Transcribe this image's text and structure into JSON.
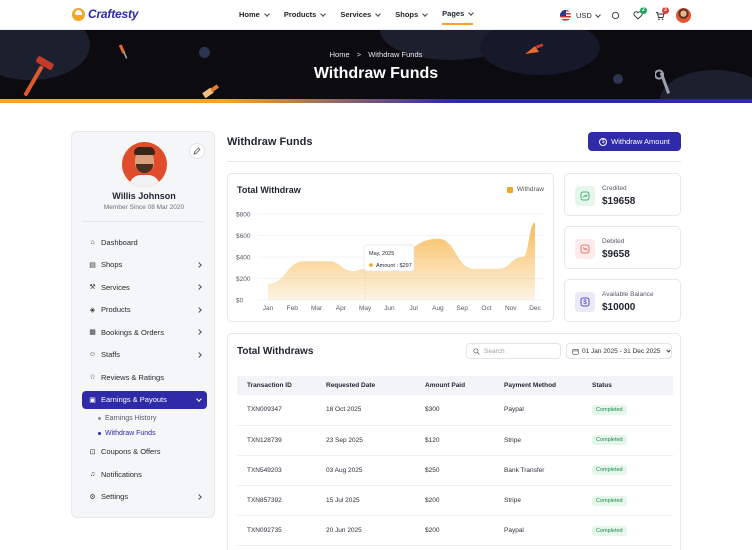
{
  "nav": {
    "logo": "Craftesty",
    "menu": [
      {
        "label": "Home"
      },
      {
        "label": "Products"
      },
      {
        "label": "Services"
      },
      {
        "label": "Shops"
      },
      {
        "label": "Pages"
      }
    ],
    "currency": "USD",
    "wishlist_count": "2",
    "cart_count": "3"
  },
  "hero": {
    "breadcrumb_home": "Home",
    "breadcrumb_sep": ">",
    "breadcrumb_current": "Withdraw Funds",
    "title": "Withdraw Funds"
  },
  "profile": {
    "name": "Willis Johnson",
    "since": "Member Since 08 Mar 2020"
  },
  "sidebar": {
    "items": [
      {
        "label": "Dashboard",
        "icon": "home-icon"
      },
      {
        "label": "Shops",
        "icon": "shop-icon"
      },
      {
        "label": "Services",
        "icon": "services-icon"
      },
      {
        "label": "Products",
        "icon": "box-icon"
      },
      {
        "label": "Bookings & Orders",
        "icon": "calendar-icon"
      },
      {
        "label": "Staffs",
        "icon": "users-icon"
      },
      {
        "label": "Reviews & Ratings",
        "icon": "star-icon"
      },
      {
        "label": "Earnings & Payouts",
        "icon": "wallet-icon"
      },
      {
        "label": "Coupons & Offers",
        "icon": "coupon-icon"
      },
      {
        "label": "Notifications",
        "icon": "bell-icon"
      },
      {
        "label": "Settings",
        "icon": "gear-icon"
      }
    ],
    "sub_items": [
      {
        "label": "Earnings History"
      },
      {
        "label": "Withdraw Funds"
      }
    ]
  },
  "main": {
    "title": "Withdraw Funds",
    "withdraw_button": "Withdraw Amount"
  },
  "stats": [
    {
      "label": "Credited",
      "value": "$19658",
      "color": "#22a55a"
    },
    {
      "label": "Debited",
      "value": "$9658",
      "color": "#e2584a"
    },
    {
      "label": "Available Balance",
      "value": "$10000",
      "color": "#2f2aa8"
    }
  ],
  "chart_data": {
    "type": "area",
    "title": "Total Withdraw",
    "series": [
      {
        "name": "Withdraw",
        "values": [
          150,
          360,
          360,
          270,
          290,
          410,
          570,
          290,
          290,
          400,
          720
        ]
      }
    ],
    "categories": [
      "Jan",
      "Feb",
      "Mar",
      "Apr",
      "May",
      "Jun",
      "Jul",
      "Aug",
      "Sep",
      "Oct",
      "Nov",
      "Dec"
    ],
    "x": [
      0,
      1.5,
      2.5,
      3.5,
      4,
      5,
      7,
      8.5,
      9.5,
      10.5,
      11
    ],
    "y_ticks": [
      "$0",
      "$200",
      "$400",
      "$600",
      "$800"
    ],
    "ylim": [
      0,
      800
    ],
    "color": "#f4a523",
    "tooltip": {
      "title": "May, 2025",
      "label": "Amount : $297"
    }
  },
  "table": {
    "title": "Total Withdraws",
    "search_placeholder": "Search",
    "date_range": "01 Jan 2025 - 31 Dec 2025",
    "columns": [
      "Transaction ID",
      "Requested Date",
      "Amount Paid",
      "Payment Method",
      "Status"
    ],
    "rows": [
      [
        "TXN009347",
        "18 Oct 2025",
        "$300",
        "Paypal",
        "Completed"
      ],
      [
        "TXN128739",
        "23 Sep 2025",
        "$120",
        "Stripe",
        "Completed"
      ],
      [
        "TXN549203",
        "03 Aug 2025",
        "$250",
        "Bank Transfer",
        "Completed"
      ],
      [
        "TXN857392",
        "15 Jul 2025",
        "$200",
        "Stripe",
        "Completed"
      ],
      [
        "TXN092735",
        "20 Jun 2025",
        "$200",
        "Paypal",
        "Completed"
      ]
    ]
  }
}
